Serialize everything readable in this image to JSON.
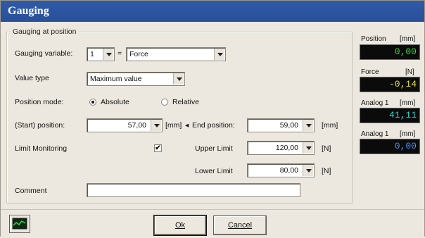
{
  "window": {
    "title": "Gauging"
  },
  "group": {
    "legend": "Gauging at position"
  },
  "form": {
    "gauging_variable_label": "Gauging variable:",
    "gauging_variable_index": "1",
    "equals": "=",
    "gauging_variable_value": "Force",
    "value_type_label": "Value type",
    "value_type_value": "Maximum value",
    "position_mode_label": "Position mode:",
    "position_mode_absolute": "Absolute",
    "position_mode_relative": "Relative",
    "position_mode_selected": "Absolute",
    "start_position_label": "(Start) position:",
    "start_position_value": "57,00",
    "start_position_unit": "[mm]",
    "end_position_label": "End position:",
    "end_position_value": "59,00",
    "end_position_unit": "[mm]",
    "limit_monitoring_label": "Limit Monitoring",
    "limit_monitoring_checked": true,
    "upper_limit_label": "Upper Limit",
    "upper_limit_value": "120,00",
    "upper_limit_unit": "[N]",
    "lower_limit_label": "Lower Limit",
    "lower_limit_value": "80,00",
    "lower_limit_unit": "[N]",
    "comment_label": "Comment",
    "comment_value": ""
  },
  "side_panel": {
    "position_label": "Position",
    "position_unit": "[mm]",
    "position_value": "0,00",
    "position_color": "#33dd33",
    "force_label": "Force",
    "force_unit": "[N]",
    "force_value": "-0,14",
    "force_color": "#e6e633",
    "analog1_label": "Analog 1",
    "analog1_unit": "[mm]",
    "analog1_value": "41,11",
    "analog1_color": "#33dddd",
    "analog2_label": "Analog 1",
    "analog2_unit": "[mm]",
    "analog2_value": "0,00",
    "analog2_color": "#4a90ff"
  },
  "buttons": {
    "ok_label": "Ok",
    "cancel_label": "Cancel",
    "chart_icon": "chart-icon"
  }
}
